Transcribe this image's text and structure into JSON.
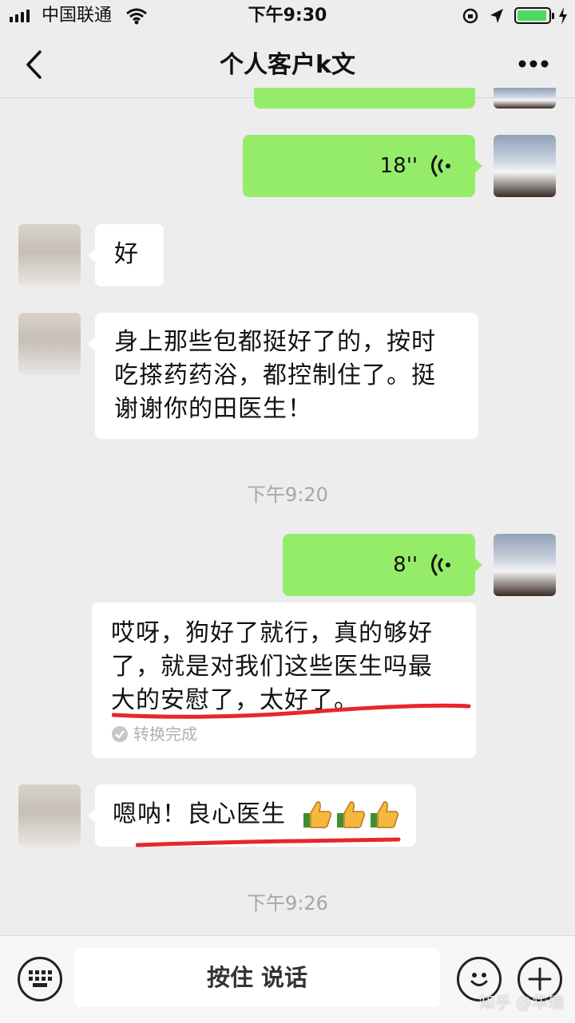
{
  "status_bar": {
    "carrier": "中国联通",
    "time": "下午9:30"
  },
  "nav": {
    "title": "个人客户k文"
  },
  "messages": [
    {
      "side": "right",
      "kind": "voice",
      "duration": "18''"
    },
    {
      "side": "left",
      "kind": "text",
      "text": "好"
    },
    {
      "side": "left",
      "kind": "text",
      "lines": [
        "身上那些包都挺好了的，按时",
        "吃搽药药浴，都控制住了。挺",
        "谢谢你的田医生！"
      ]
    },
    {
      "kind": "timestamp",
      "text": "下午9:20"
    },
    {
      "side": "right",
      "kind": "voice",
      "duration": "8''"
    },
    {
      "side": "left",
      "kind": "text",
      "lines": [
        "哎呀，狗好了就行，真的够好",
        "了，就是对我们这些医生吗最",
        "大的安慰了，太好了。"
      ],
      "status": "转换完成"
    },
    {
      "side": "left",
      "kind": "text",
      "text": "嗯呐！良心医生"
    },
    {
      "kind": "timestamp",
      "text": "下午9:26"
    }
  ],
  "input_bar": {
    "talk_label": "按住 说话"
  },
  "icons": {
    "back": "chevron-left-icon",
    "more": "more-dots-icon",
    "voice": "voice-wave-icon",
    "keyboard": "keyboard-icon",
    "emoji": "emoji-icon",
    "add": "plus-icon",
    "thumbs": "thumbs-up-icon"
  },
  "watermark": "知乎 @华瑞",
  "colors": {
    "bubble_green": "#95ec69",
    "underline_red": "#e8262c",
    "background": "#ededed"
  }
}
